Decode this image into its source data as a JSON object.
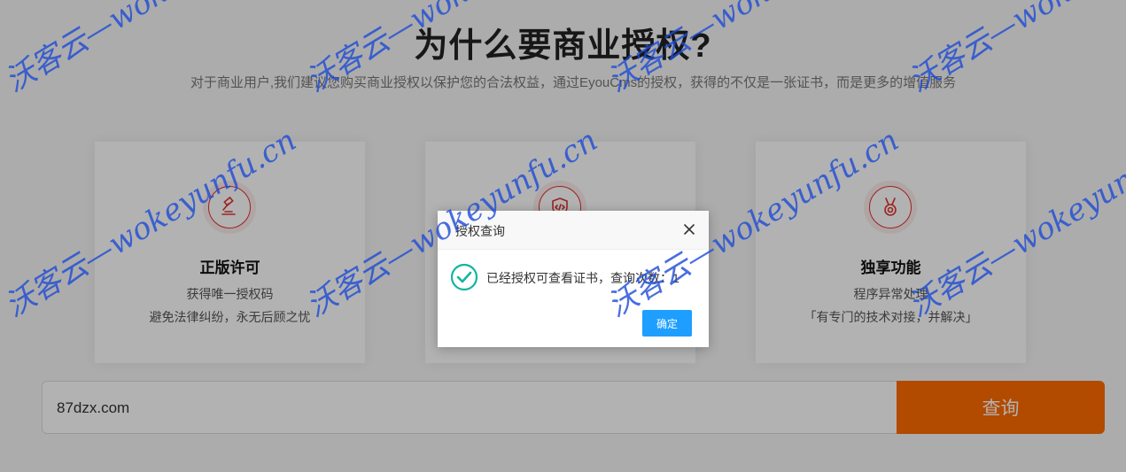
{
  "page": {
    "heading": "为什么要商业授权?",
    "subheading": "对于商业用户,我们建议您购买商业授权以保护您的合法权益，通过EyouCms的授权，获得的不仅是一张证书，而是更多的增值服务"
  },
  "cards": [
    {
      "icon": "gavel-icon",
      "title": "正版许可",
      "line1": "获得唯一授权码",
      "line2": "避免法律纠纷，永无后顾之忧"
    },
    {
      "icon": "shield-code-icon",
      "title": "",
      "line1": "",
      "line2": ""
    },
    {
      "icon": "medal-icon",
      "title": "独享功能",
      "line1": "程序异常处理",
      "line2": "「有专门的技术对接，并解决」"
    }
  ],
  "search": {
    "value": "87dzx.com",
    "button_label": "查询"
  },
  "dialog": {
    "title": "授权查询",
    "message": "已经授权可查看证书，查询次数：1",
    "ok_label": "确定"
  },
  "watermark": {
    "text": "沃客云—wokeyunfu.cn"
  },
  "colors": {
    "accent": "#ff6a00",
    "icon_red": "#e0322f",
    "success": "#12b5a0",
    "ok_button": "#1e9fff",
    "watermark": "#1d4bd6"
  }
}
